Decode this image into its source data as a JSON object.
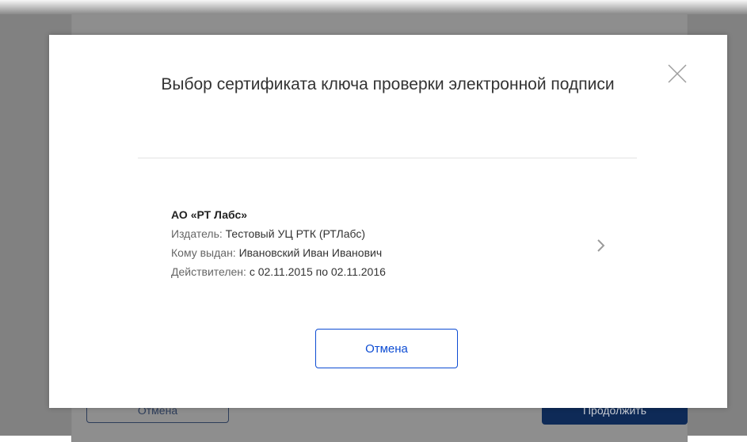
{
  "background": {
    "cancel_label": "Отмена",
    "continue_label": "Продолжить"
  },
  "modal": {
    "title": "Выбор сертификата ключа проверки электронной подписи",
    "certificate": {
      "name": "АО «РТ Лабс»",
      "issuer_label": "Издатель:",
      "issuer_value": "Тестовый УЦ РТК (РТЛабс)",
      "issued_to_label": "Кому выдан:",
      "issued_to_value": "Ивановский Иван Иванович",
      "valid_label": "Действителен:",
      "valid_value": "с 02.11.2015 по 02.11.2016"
    },
    "cancel_label": "Отмена"
  },
  "icons": {
    "close": "close-icon",
    "chevron": "chevron-right-icon"
  },
  "colors": {
    "accent": "#0d4cd3",
    "overlay": "#818181",
    "primary_dark": "#0e2a57"
  }
}
